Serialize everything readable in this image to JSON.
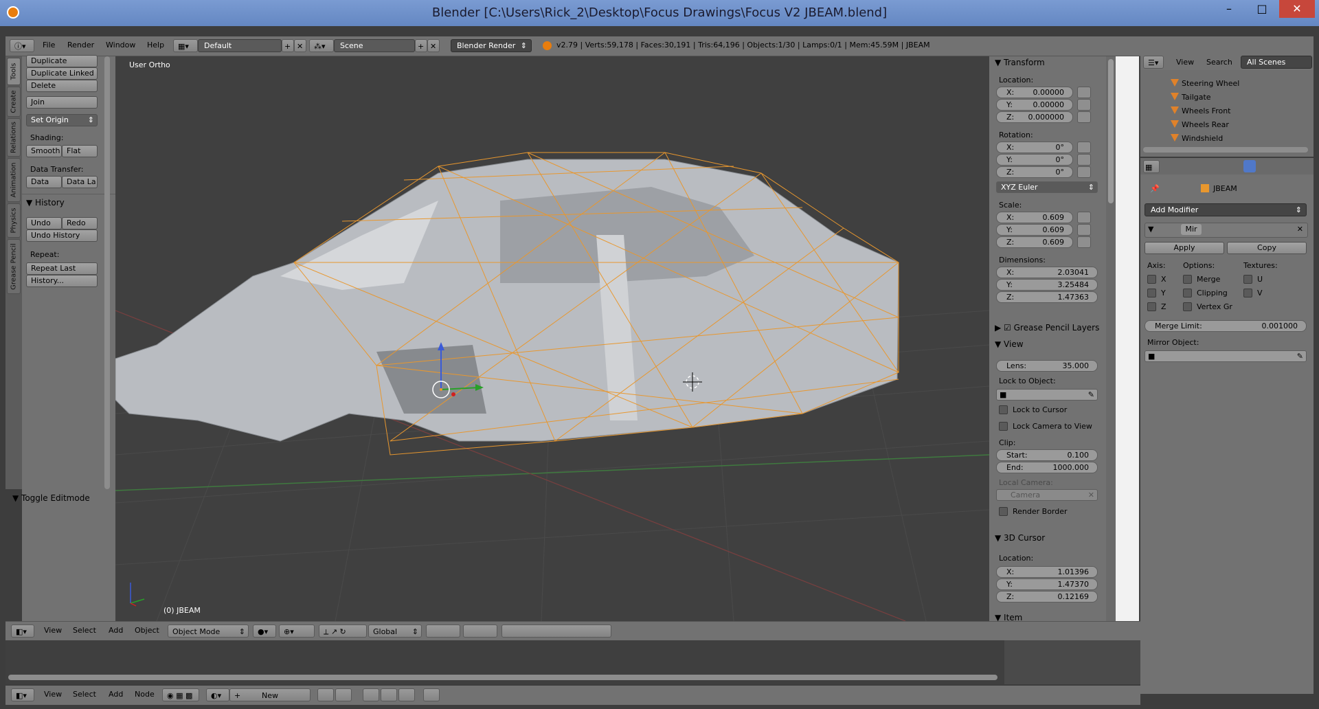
{
  "window": {
    "title": "Blender [C:\\Users\\Rick_2\\Desktop\\Focus Drawings\\Focus V2 JBEAM.blend]",
    "minimize": "–",
    "maximize": "□",
    "close": "✕"
  },
  "info_header": {
    "menus": [
      "File",
      "Render",
      "Window",
      "Help"
    ],
    "layout": "Default",
    "scene": "Scene",
    "engine": "Blender Render",
    "stats": "v2.79 | Verts:59,178 | Faces:30,191 | Tris:64,196 | Objects:1/30 | Lamps:0/1 | Mem:45.59M | JBEAM"
  },
  "tabs": [
    "Tools",
    "Create",
    "Relations",
    "Animation",
    "Physics",
    "Grease Pencil"
  ],
  "tool_shelf": {
    "buttons": [
      "Duplicate",
      "Duplicate Linked",
      "Delete"
    ],
    "join": "Join",
    "set_origin": "Set Origin",
    "shading_label": "Shading:",
    "smooth": "Smooth",
    "flat": "Flat",
    "data_transfer_label": "Data Transfer:",
    "data": "Data",
    "data_la": "Data La",
    "history_header": "History",
    "undo": "Undo",
    "redo": "Redo",
    "undo_history": "Undo History",
    "repeat_label": "Repeat:",
    "repeat_last": "Repeat Last",
    "history_btn": "History...",
    "toggle_editmode": "Toggle Editmode"
  },
  "viewport": {
    "label": "User Ortho",
    "object_label": "(0) JBEAM",
    "accent_wire": "#e8972e",
    "car_body": "#b9bcc1",
    "grid_line": "#4a4a4a"
  },
  "npanel": {
    "transform_header": "Transform",
    "location_label": "Location:",
    "location": [
      {
        "k": "X:",
        "v": "0.00000"
      },
      {
        "k": "Y:",
        "v": "0.00000"
      },
      {
        "k": "Z:",
        "v": "0.000000"
      }
    ],
    "rotation_label": "Rotation:",
    "rotation": [
      {
        "k": "X:",
        "v": "0°"
      },
      {
        "k": "Y:",
        "v": "0°"
      },
      {
        "k": "Z:",
        "v": "0°"
      }
    ],
    "rotation_mode": "XYZ Euler",
    "scale_label": "Scale:",
    "scale": [
      {
        "k": "X:",
        "v": "0.609"
      },
      {
        "k": "Y:",
        "v": "0.609"
      },
      {
        "k": "Z:",
        "v": "0.609"
      }
    ],
    "dimensions_label": "Dimensions:",
    "dimensions": [
      {
        "k": "X:",
        "v": "2.03041"
      },
      {
        "k": "Y:",
        "v": "3.25484"
      },
      {
        "k": "Z:",
        "v": "1.47363"
      }
    ],
    "grease_pencil_layers": "Grease Pencil Layers",
    "view_header": "View",
    "lens_k": "Lens:",
    "lens_v": "35.000",
    "lock_to_object": "Lock to Object:",
    "lock_to_cursor": "Lock to Cursor",
    "lock_camera_to_view": "Lock Camera to View",
    "clip_label": "Clip:",
    "clip_start_k": "Start:",
    "clip_start_v": "0.100",
    "clip_end_k": "End:",
    "clip_end_v": "1000.000",
    "local_camera": "Local Camera:",
    "camera": "Camera",
    "render_border": "Render Border",
    "cursor_header": "3D Cursor",
    "cursor_location_label": "Location:",
    "cursor": [
      {
        "k": "X:",
        "v": "1.01396"
      },
      {
        "k": "Y:",
        "v": "1.47370"
      },
      {
        "k": "Z:",
        "v": "0.12169"
      }
    ],
    "item_header": "Item"
  },
  "outliner": {
    "view": "View",
    "search": "Search",
    "scenes": "All Scenes",
    "items": [
      "Steering Wheel",
      "Tailgate",
      "Wheels Front",
      "Wheels Rear",
      "Windshield"
    ]
  },
  "properties": {
    "object_name": "JBEAM",
    "add_modifier": "Add Modifier",
    "modifier_name": "Mir",
    "apply": "Apply",
    "copy": "Copy",
    "axis_label": "Axis:",
    "options_label": "Options:",
    "textures_label": "Textures:",
    "axis_x": "X",
    "axis_y": "Y",
    "axis_z": "Z",
    "merge": "Merge",
    "clipping": "Clipping",
    "vertex_gr": "Vertex Gr",
    "tex_u": "U",
    "tex_v": "V",
    "merge_limit_k": "Merge Limit:",
    "merge_limit_v": "0.001000",
    "mirror_object": "Mirror Object:"
  },
  "viewport_header": {
    "menus": [
      "View",
      "Select",
      "Add",
      "Object"
    ],
    "mode": "Object Mode",
    "orientation": "Global"
  },
  "node_header": {
    "menus": [
      "View",
      "Select",
      "Add",
      "Node"
    ],
    "new": "New"
  }
}
